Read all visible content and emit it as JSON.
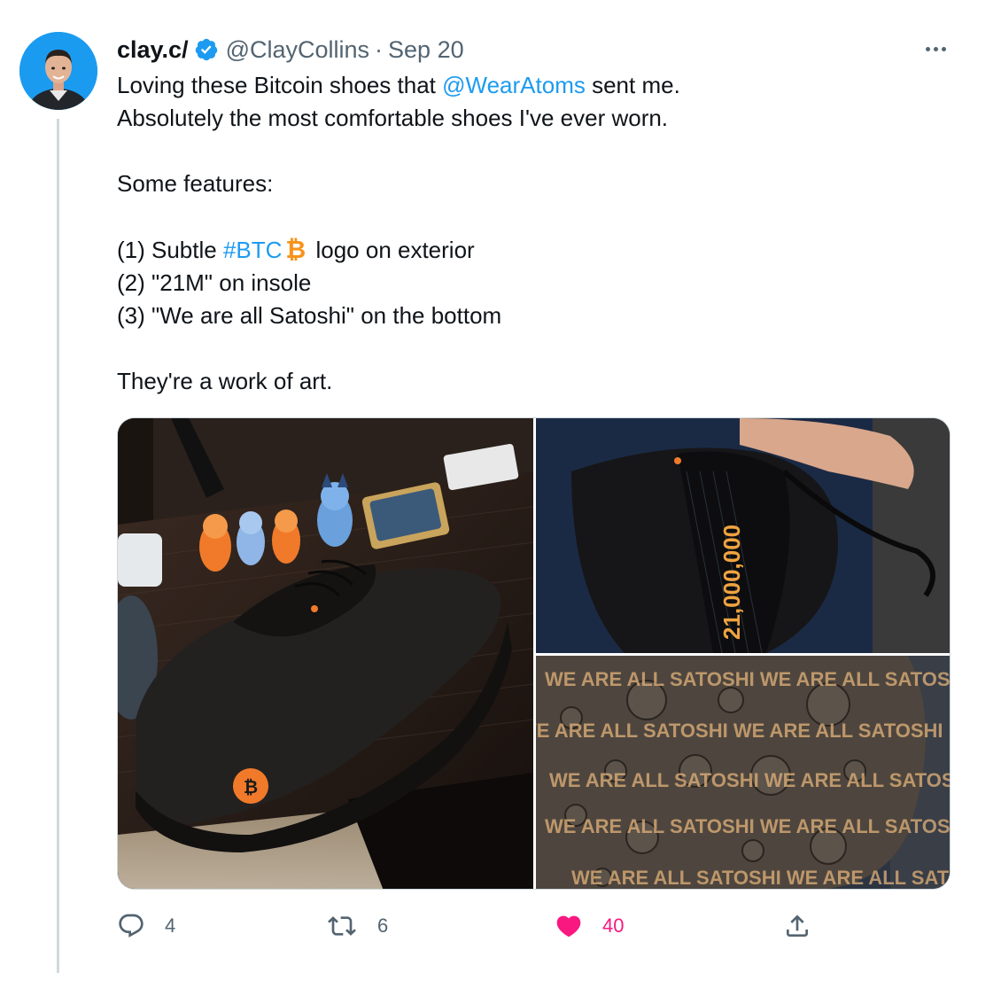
{
  "author": {
    "display_name": "clay.c/",
    "handle": "@ClayCollins",
    "separator": "·",
    "date": "Sep 20"
  },
  "tweet": {
    "line1_pre": "Loving these Bitcoin shoes that ",
    "mention": "@WearAtoms",
    "line1_post": " sent me.",
    "line2": "Absolutely the most comfortable shoes I've ever worn.",
    "features_heading": "Some features:",
    "feature1_pre": "(1) Subtle ",
    "hashtag": "#BTC",
    "feature1_post": " logo on exterior",
    "feature2": "(2) \"21M\" on insole",
    "feature3": "(3) \"We are all Satoshi\" on the bottom",
    "closing": "They're a work of art."
  },
  "media": {
    "insole_print": "21,000,000",
    "sole_print": "WE ARE ALL SATOSHI WE ARE ALL SATOSHI",
    "logo_glyph": "₿"
  },
  "actions": {
    "reply_count": "4",
    "retweet_count": "6",
    "like_count": "40",
    "like_color": "#f91880"
  },
  "colors": {
    "accent": "#1d9bf0",
    "bitcoin_orange": "#f7931a",
    "muted": "#536471"
  },
  "icons": {
    "verified": "verified-badge-icon",
    "more": "more-icon",
    "reply": "reply-icon",
    "retweet": "retweet-icon",
    "like": "heart-icon",
    "share": "share-icon",
    "btc": "bitcoin-emoji-icon"
  }
}
